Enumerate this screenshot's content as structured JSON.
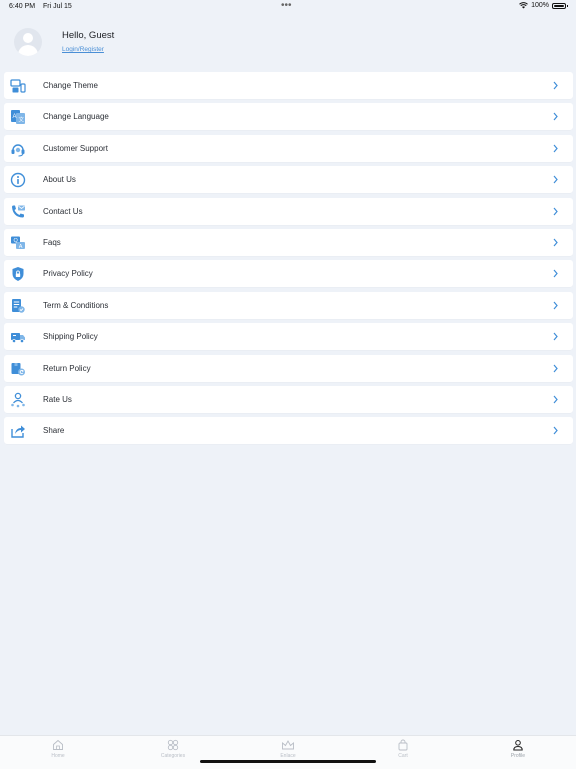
{
  "status": {
    "time": "6:40 PM",
    "date": "Fri Jul 15",
    "battery": "100%"
  },
  "profile": {
    "greeting": "Hello, Guest",
    "login_link": "Login/Register"
  },
  "menu": [
    {
      "label": "Change Theme",
      "icon": "theme-icon"
    },
    {
      "label": "Change Language",
      "icon": "language-icon"
    },
    {
      "label": "Customer Support",
      "icon": "headset-icon"
    },
    {
      "label": "About Us",
      "icon": "info-icon"
    },
    {
      "label": "Contact Us",
      "icon": "phone-icon"
    },
    {
      "label": "Faqs",
      "icon": "faq-icon"
    },
    {
      "label": "Privacy Policy",
      "icon": "shield-lock-icon"
    },
    {
      "label": "Term & Conditions",
      "icon": "document-check-icon"
    },
    {
      "label": "Shipping Policy",
      "icon": "truck-icon"
    },
    {
      "label": "Return Policy",
      "icon": "return-box-icon"
    },
    {
      "label": "Rate Us",
      "icon": "rate-user-icon"
    },
    {
      "label": "Share",
      "icon": "share-icon"
    }
  ],
  "tabs": [
    {
      "label": "Home",
      "icon": "home-icon"
    },
    {
      "label": "Categories",
      "icon": "categories-icon"
    },
    {
      "label": "Enlace",
      "icon": "crown-icon"
    },
    {
      "label": "Cart",
      "icon": "cart-icon"
    },
    {
      "label": "Profile",
      "icon": "profile-icon",
      "active": true
    }
  ],
  "colors": {
    "accent": "#3f8ed8",
    "background": "#eef2f8",
    "card": "#ffffff"
  }
}
